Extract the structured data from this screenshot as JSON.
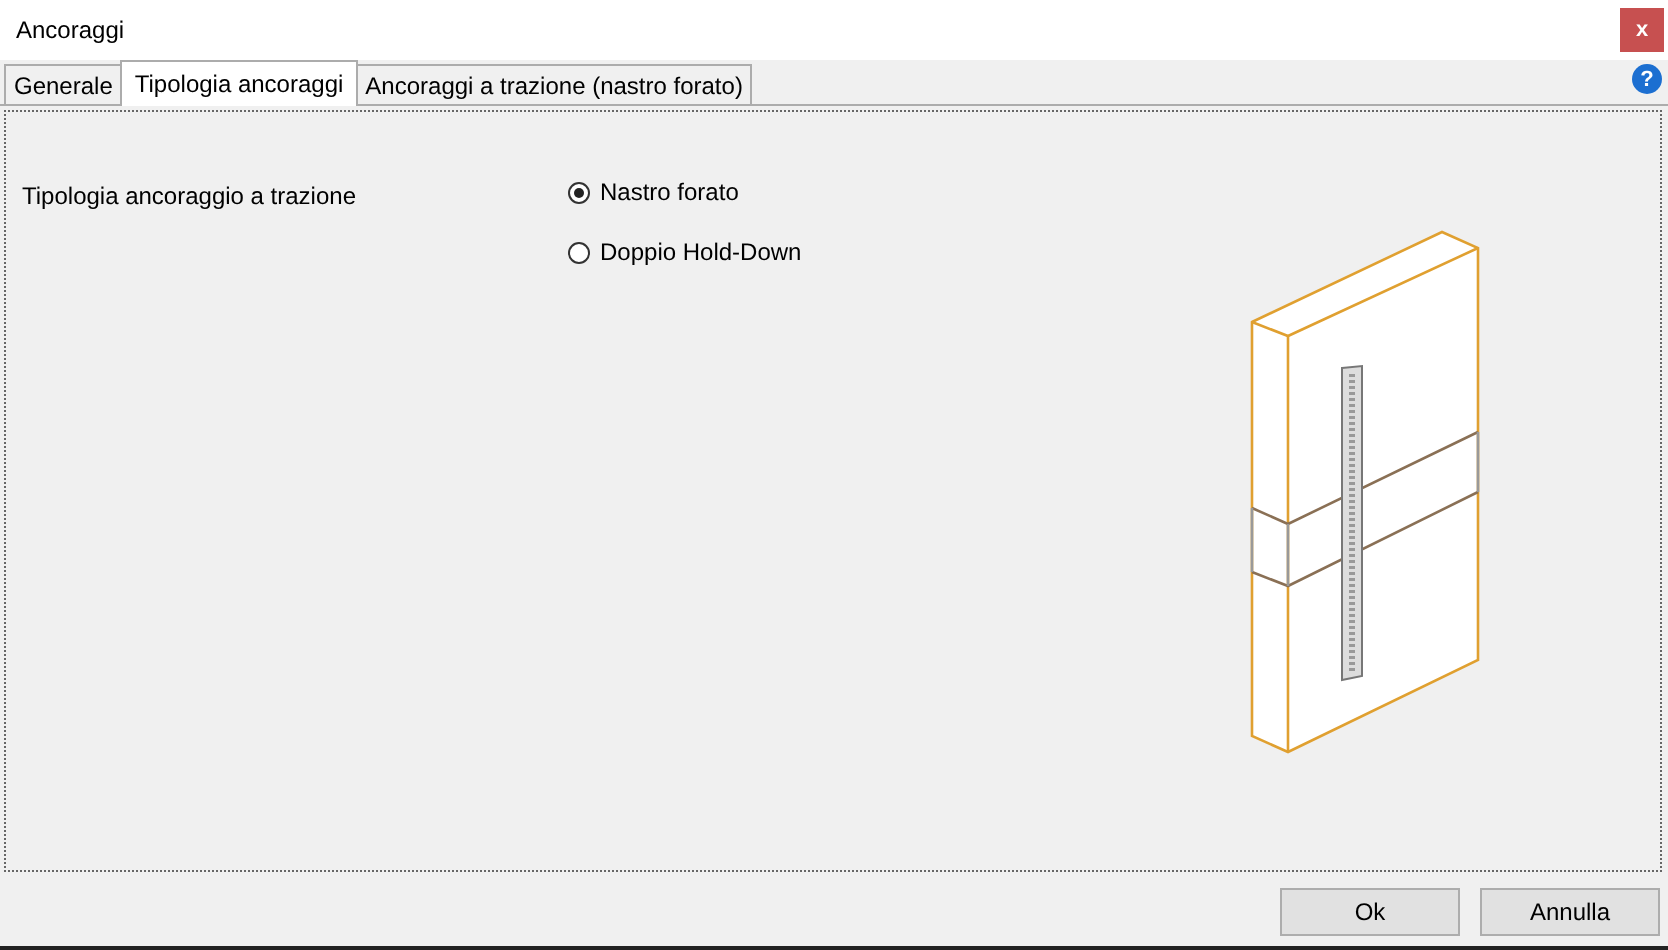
{
  "window": {
    "title": "Ancoraggi",
    "close": "x"
  },
  "tabs": [
    {
      "label": "Generale",
      "selected": false
    },
    {
      "label": "Tipologia ancoraggi",
      "selected": true
    },
    {
      "label": "Ancoraggi a trazione (nastro forato)",
      "selected": false
    }
  ],
  "help": "?",
  "field": {
    "label": "Tipologia ancoraggio a trazione",
    "options": [
      {
        "label": "Nastro forato",
        "selected": true
      },
      {
        "label": "Doppio Hold-Down",
        "selected": false
      }
    ]
  },
  "buttons": [
    "Ok",
    "Annulla"
  ]
}
